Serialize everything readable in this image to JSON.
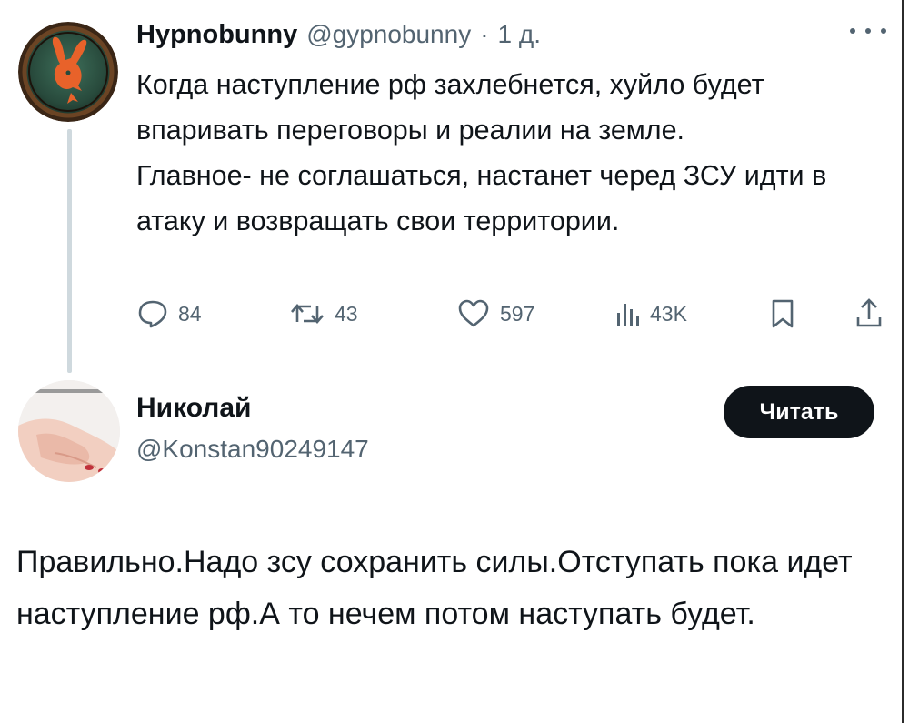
{
  "tweet1": {
    "display_name": "Hypnobunny",
    "handle": "@gypnobunny",
    "separator": "·",
    "time": "1 д.",
    "text_para1": "Когда наступление рф захлебнется, хуйло будет впаривать переговоры и реалии на земле.",
    "text_para2": "Главное- не соглашаться, настанет черед ЗСУ идти в атаку и возвращать свои территории.",
    "replies": "84",
    "retweets": "43",
    "likes": "597",
    "views": "43K"
  },
  "tweet2": {
    "display_name": "Николай",
    "handle": "@Konstan90249147",
    "follow_label": "Читать",
    "text": "Правильно.Надо зсу сохранить силы.Отступать пока идет наступление рф.А то нечем потом наступать будет."
  },
  "colors": {
    "text": "#0f1419",
    "secondary": "#536471",
    "thread_line": "#cfd9de",
    "button_bg": "#0f1419"
  },
  "icons": {
    "avatar1": "playboy-bunny-logo",
    "replies": "reply-icon",
    "retweets": "retweet-icon",
    "likes": "heart-icon",
    "views": "views-bar-chart-icon",
    "bookmark": "bookmark-icon",
    "share": "share-icon",
    "more": "more-dots-icon"
  }
}
